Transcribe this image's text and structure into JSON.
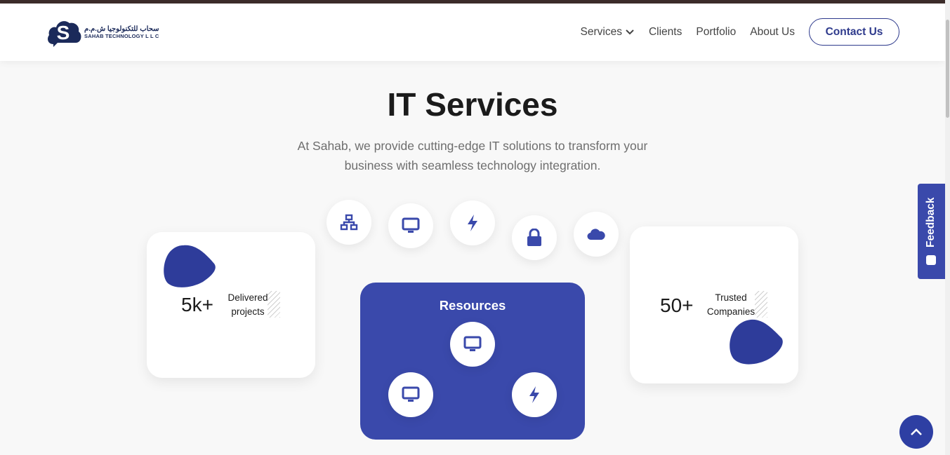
{
  "header": {
    "logo_arabic": "سحاب للتكنولوجيا ش.م.م",
    "logo_english": "SAHAB TECHNOLOGY L L C",
    "nav": [
      {
        "label": "Services"
      },
      {
        "label": "Clients"
      },
      {
        "label": "Portfolio"
      },
      {
        "label": "About Us"
      }
    ],
    "contact_label": "Contact Us"
  },
  "hero": {
    "title": "IT Services",
    "subtitle": "At Sahab, we provide cutting-edge IT solutions to transform your business with seamless technology integration."
  },
  "service_icons": [
    "network-icon",
    "monitor-icon",
    "bolt-icon",
    "lock-icon",
    "cloud-icon"
  ],
  "stats": [
    {
      "number": "5k+",
      "label_line1": "Delivered",
      "label_line2": "projects"
    },
    {
      "number": "50+",
      "label_line1": "Trusted",
      "label_line2": "Companies"
    }
  ],
  "resources": {
    "title": "Resources",
    "icons": [
      "monitor-icon",
      "monitor-icon",
      "bolt-icon"
    ]
  },
  "feedback_label": "Feedback",
  "colors": {
    "accent": "#3a49ab",
    "brand_dark": "#1b2a5a",
    "top_border": "#3d2d2b"
  }
}
